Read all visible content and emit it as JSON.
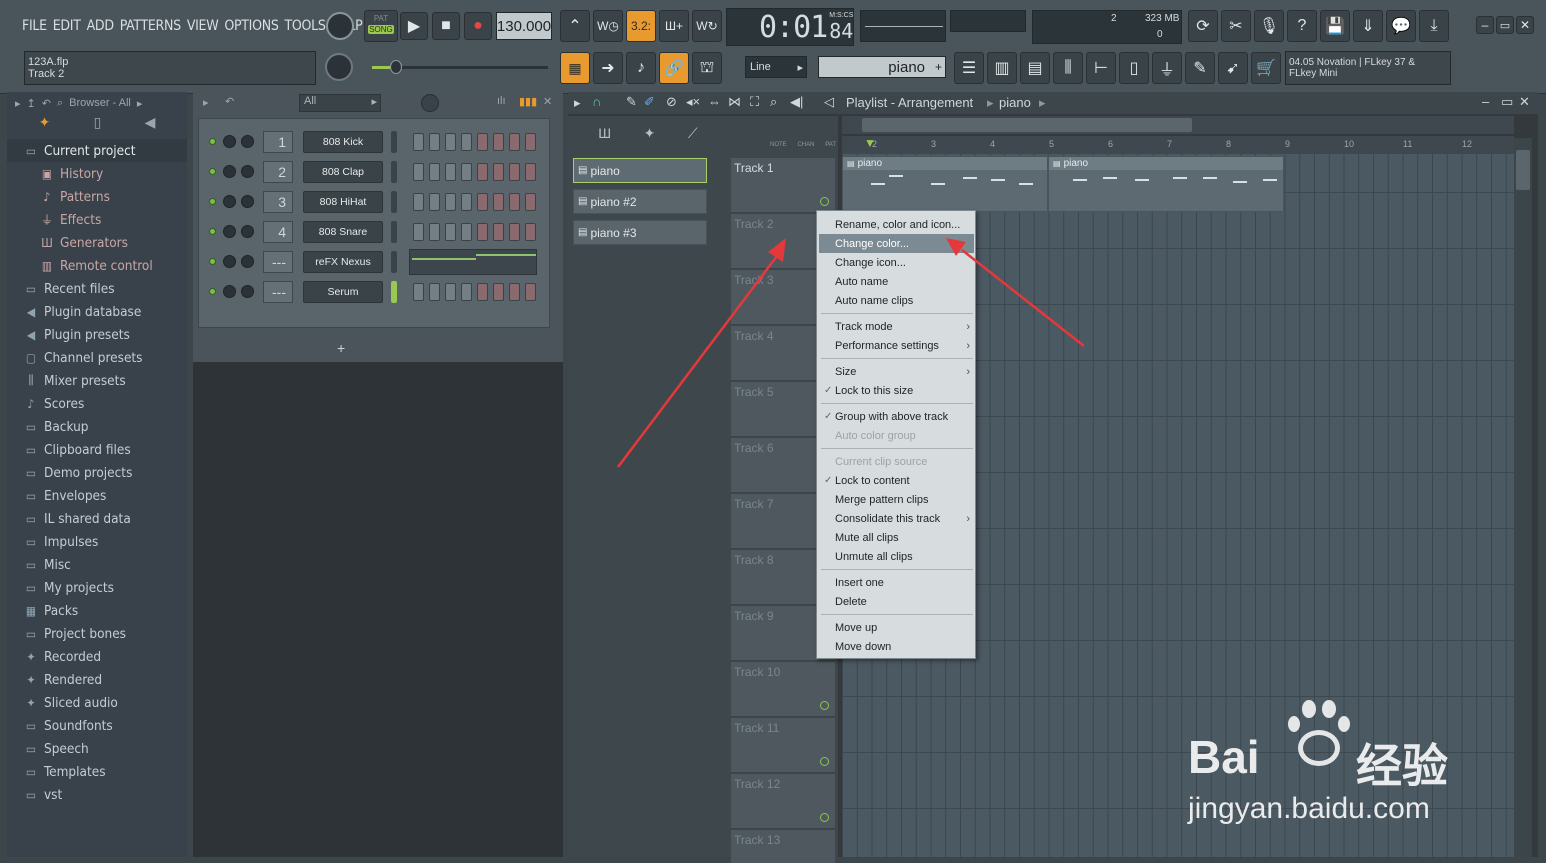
{
  "menu": [
    "FILE",
    "EDIT",
    "ADD",
    "PATTERNS",
    "VIEW",
    "OPTIONS",
    "TOOLS",
    "HELP"
  ],
  "transport": {
    "pat": "PAT",
    "song": "SONG",
    "tempo": "130.000",
    "time": "0:01",
    "time_frac": "84",
    "time_unit": "M:S:CS"
  },
  "memory": {
    "cpu": "2",
    "ram": "323 MB",
    "poly": "0"
  },
  "project": {
    "file": "123A.flp",
    "track": "Track 2"
  },
  "snap": "Line",
  "pattern_name": "piano",
  "news": {
    "line1": "04.05  Novation | FLkey 37 &",
    "line2": "FLkey Mini"
  },
  "browser": {
    "title": "Browser - All",
    "items": [
      {
        "label": "Current project",
        "icon": "folder-icon",
        "type": "cp"
      },
      {
        "label": "History",
        "icon": "history-icon",
        "type": "sub"
      },
      {
        "label": "Patterns",
        "icon": "note-icon",
        "type": "sub"
      },
      {
        "label": "Effects",
        "icon": "plug-icon",
        "type": "sub"
      },
      {
        "label": "Generators",
        "icon": "keys-icon",
        "type": "sub"
      },
      {
        "label": "Remote control",
        "icon": "remote-icon",
        "type": "sub"
      },
      {
        "label": "Recent files",
        "icon": "folder-icon",
        "type": "top"
      },
      {
        "label": "Plugin database",
        "icon": "speaker-icon",
        "type": "top"
      },
      {
        "label": "Plugin presets",
        "icon": "speaker-icon",
        "type": "top"
      },
      {
        "label": "Channel presets",
        "icon": "channel-icon",
        "type": "top"
      },
      {
        "label": "Mixer presets",
        "icon": "mixer-icon",
        "type": "top"
      },
      {
        "label": "Scores",
        "icon": "note-icon",
        "type": "top"
      },
      {
        "label": "Backup",
        "icon": "folder-icon",
        "type": "top"
      },
      {
        "label": "Clipboard files",
        "icon": "folder-icon",
        "type": "top"
      },
      {
        "label": "Demo projects",
        "icon": "folder-icon",
        "type": "top"
      },
      {
        "label": "Envelopes",
        "icon": "folder-icon",
        "type": "top"
      },
      {
        "label": "IL shared data",
        "icon": "folder-icon",
        "type": "top"
      },
      {
        "label": "Impulses",
        "icon": "folder-icon",
        "type": "top"
      },
      {
        "label": "Misc",
        "icon": "folder-icon",
        "type": "top"
      },
      {
        "label": "My projects",
        "icon": "folder-icon",
        "type": "top"
      },
      {
        "label": "Packs",
        "icon": "packs-icon",
        "type": "top"
      },
      {
        "label": "Project bones",
        "icon": "folder-icon",
        "type": "top"
      },
      {
        "label": "Recorded",
        "icon": "star-icon",
        "type": "top"
      },
      {
        "label": "Rendered",
        "icon": "star-icon",
        "type": "top"
      },
      {
        "label": "Sliced audio",
        "icon": "star-icon",
        "type": "top"
      },
      {
        "label": "Soundfonts",
        "icon": "folder-icon",
        "type": "top"
      },
      {
        "label": "Speech",
        "icon": "folder-icon",
        "type": "top"
      },
      {
        "label": "Templates",
        "icon": "folder-icon",
        "type": "top"
      },
      {
        "label": "vst",
        "icon": "folder-icon",
        "type": "top"
      }
    ]
  },
  "rack": {
    "filter": "All",
    "add": "+",
    "channels": [
      {
        "num": "1",
        "name": "808 Kick"
      },
      {
        "num": "2",
        "name": "808 Clap"
      },
      {
        "num": "3",
        "name": "808 HiHat"
      },
      {
        "num": "4",
        "name": "808 Snare"
      },
      {
        "num": "---",
        "name": "reFX Nexus"
      },
      {
        "num": "---",
        "name": "Serum"
      }
    ]
  },
  "playlist": {
    "title": "Playlist - Arrangement",
    "pattern": "piano",
    "col_labels": [
      "NOTE",
      "CHAN",
      "PAT"
    ],
    "patterns": [
      "piano",
      "piano #2",
      "piano #3"
    ],
    "tracks": [
      "Track 1",
      "Track 2",
      "Track 3",
      "Track 4",
      "Track 5",
      "Track 6",
      "Track 7",
      "Track 8",
      "Track 9",
      "Track 10",
      "Track 11",
      "Track 12",
      "Track 13"
    ],
    "ruler": [
      "2",
      "3",
      "4",
      "5",
      "6",
      "7",
      "8",
      "9",
      "10",
      "11",
      "12"
    ],
    "clips": [
      "piano",
      "piano"
    ]
  },
  "context_menu": [
    {
      "label": "Rename, color and icon...",
      "state": "normal"
    },
    {
      "label": "Change color...",
      "state": "highlight"
    },
    {
      "label": "Change icon...",
      "state": "normal"
    },
    {
      "label": "Auto name",
      "state": "normal"
    },
    {
      "label": "Auto name clips",
      "state": "normal"
    },
    {
      "label": "Track mode",
      "state": "submenu"
    },
    {
      "label": "Performance settings",
      "state": "submenu"
    },
    {
      "label": "Size",
      "state": "submenu"
    },
    {
      "label": "Lock to this size",
      "state": "checked"
    },
    {
      "label": "Group with above track",
      "state": "checked"
    },
    {
      "label": "Auto color group",
      "state": "disabled"
    },
    {
      "label": "Current clip source",
      "state": "disabled"
    },
    {
      "label": "Lock to content",
      "state": "checked"
    },
    {
      "label": "Merge pattern clips",
      "state": "normal"
    },
    {
      "label": "Consolidate this track",
      "state": "submenu"
    },
    {
      "label": "Mute all clips",
      "state": "normal"
    },
    {
      "label": "Unmute all clips",
      "state": "normal"
    },
    {
      "label": "Insert one",
      "state": "normal"
    },
    {
      "label": "Delete",
      "state": "normal"
    },
    {
      "label": "Move up",
      "state": "normal"
    },
    {
      "label": "Move down",
      "state": "normal"
    }
  ],
  "watermark": {
    "brand": "Bai",
    "brand2": "经验",
    "url": "jingyan.baidu.com"
  },
  "colors": {
    "accent": "#e99a2e",
    "arrow": "#e83a3a",
    "highlight": "#7b8a93",
    "led": "#78c04a"
  }
}
